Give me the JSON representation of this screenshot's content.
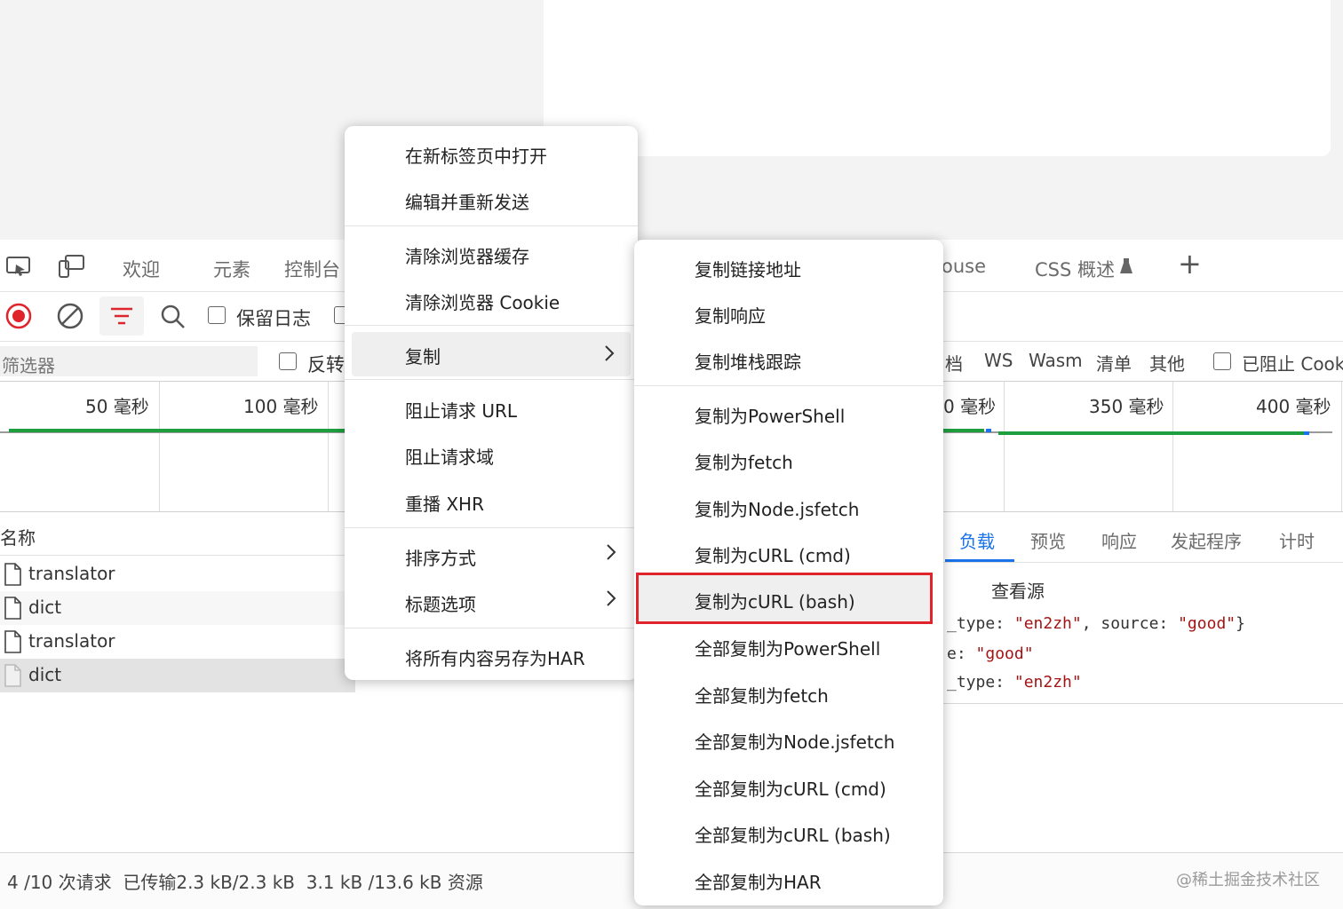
{
  "toolbar": {
    "tabs": [
      "欢迎",
      "元素",
      "控制台"
    ],
    "tab_partial_right": "ouse",
    "css_tab": "CSS 概述",
    "add_tab": "+"
  },
  "network": {
    "preserve_log": "保留日志",
    "filter_placeholder": "筛选器",
    "invert": "反转",
    "types_partial": "档",
    "types": [
      "WS",
      "Wasm",
      "清单",
      "其他"
    ],
    "blocked_cookies": "已阻止 Cook",
    "timeline_left": [
      "50 毫秒",
      "100 毫秒"
    ],
    "timeline_right_partial": "0 毫秒",
    "timeline_right": [
      "350 毫秒",
      "400 毫秒"
    ],
    "name_header": "名称",
    "requests": [
      "translator",
      "dict",
      "translator",
      "dict"
    ],
    "status_bar": "4 /10 次请求  已传输2.3 kB/2.3 kB  3.1 kB /13.6 kB 资源"
  },
  "details": {
    "tabs": [
      "负载",
      "预览",
      "响应",
      "发起程序",
      "计时"
    ],
    "view_source": "查看源",
    "line1_prefix": "_type: ",
    "line1_v1": "\"en2zh\"",
    "line1_mid": ", source: ",
    "line1_v2": "\"good\"",
    "line1_suffix": "}",
    "line2_prefix": "e: ",
    "line2_v": "\"good\"",
    "line3_prefix": "_type: ",
    "line3_v": "\"en2zh\""
  },
  "context_menu": {
    "items": [
      "在新标签页中打开",
      "编辑并重新发送",
      "清除浏览器缓存",
      "清除浏览器 Cookie",
      "复制",
      "阻止请求 URL",
      "阻止请求域",
      "重播 XHR",
      "排序方式",
      "标题选项",
      "将所有内容另存为HAR"
    ]
  },
  "copy_submenu": {
    "items": [
      "复制链接地址",
      "复制响应",
      "复制堆栈跟踪",
      "复制为PowerShell",
      "复制为fetch",
      "复制为Node.jsfetch",
      "复制为cURL (cmd)",
      "复制为cURL (bash)",
      "全部复制为PowerShell",
      "全部复制为fetch",
      "全部复制为Node.jsfetch",
      "全部复制为cURL (cmd)",
      "全部复制为cURL (bash)",
      "全部复制为HAR"
    ],
    "highlight_color": "#e0242b"
  },
  "watermark": "@稀土掘金技术社区",
  "colors": {
    "record_red": "#e0242b",
    "accent_blue": "#1a73e8",
    "timeline_green": "#1e9e3e"
  }
}
